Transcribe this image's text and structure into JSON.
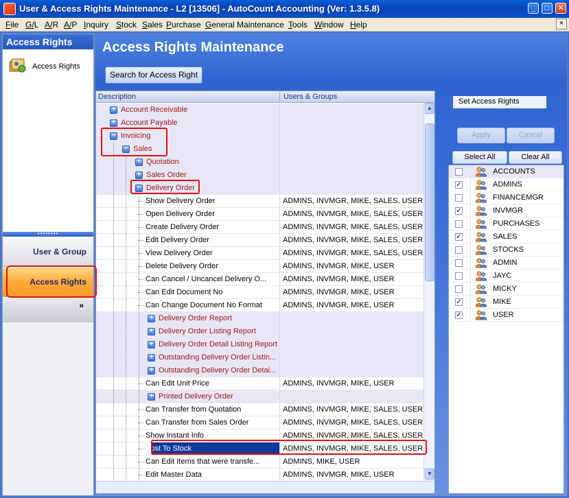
{
  "window": {
    "title": "User & Access Rights Maintenance - L2 [13506] - AutoCount Accounting (Ver: 1.3.5.8)",
    "minimize": "_",
    "maximize": "□",
    "close": "✕",
    "mdi_close": "×"
  },
  "menu": [
    "File",
    "G/L",
    "A/R",
    "A/P",
    "Inquiry",
    "Stock",
    "Sales",
    "Purchase",
    "General Maintenance",
    "Tools",
    "Window",
    "Help"
  ],
  "nav": {
    "header": "Access Rights",
    "item_label": "Access Rights",
    "splitter": "••••••••",
    "user_group": "User & Group",
    "access_rights": "Access Rights",
    "more": "»"
  },
  "main": {
    "title": "Access Rights Maintenance",
    "search_button": "Search for Access Right",
    "columns": {
      "description": "Description",
      "users": "Users & Groups"
    },
    "rows": [
      {
        "desc": "Account Receivable",
        "users": "",
        "level": 0,
        "cat": true,
        "exp": "+"
      },
      {
        "desc": "Account Payable",
        "users": "",
        "level": 0,
        "cat": true,
        "exp": "+"
      },
      {
        "desc": "Invoicing",
        "users": "",
        "level": 0,
        "cat": true,
        "exp": "−"
      },
      {
        "desc": "Sales",
        "users": "",
        "level": 1,
        "cat": true,
        "exp": "−"
      },
      {
        "desc": "Quotation",
        "users": "",
        "level": 2,
        "cat": true,
        "exp": "+"
      },
      {
        "desc": "Sales Order",
        "users": "",
        "level": 2,
        "cat": true,
        "exp": "+"
      },
      {
        "desc": "Delivery Order",
        "users": "",
        "level": 2,
        "cat": true,
        "exp": "−"
      },
      {
        "desc": "Show Delivery Order",
        "users": "ADMINS, INVMGR, MIKE, SALES, USER",
        "level": 3
      },
      {
        "desc": "Open Delivery Order",
        "users": "ADMINS, INVMGR, MIKE, SALES, USER",
        "level": 3
      },
      {
        "desc": "Create Delivery Order",
        "users": "ADMINS, INVMGR, MIKE, SALES, USER",
        "level": 3
      },
      {
        "desc": "Edit Delivery Order",
        "users": "ADMINS, INVMGR, MIKE, SALES, USER",
        "level": 3
      },
      {
        "desc": "View Delivery Order",
        "users": "ADMINS, INVMGR, MIKE, SALES, USER",
        "level": 3
      },
      {
        "desc": "Delete Delivery Order",
        "users": "ADMINS, INVMGR, MIKE, USER",
        "level": 3
      },
      {
        "desc": "Can Cancel / Uncancel Delivery O...",
        "users": "ADMINS, INVMGR, MIKE, USER",
        "level": 3
      },
      {
        "desc": "Can Edit Document No",
        "users": "ADMINS, INVMGR, MIKE, USER",
        "level": 3
      },
      {
        "desc": "Can Change Document No Format",
        "users": "ADMINS, INVMGR, MIKE, USER",
        "level": 3
      },
      {
        "desc": "Delivery Order Report",
        "users": "",
        "level": 3,
        "cat": true,
        "exp": "+"
      },
      {
        "desc": "Delivery Order Listing Report",
        "users": "",
        "level": 3,
        "cat": true,
        "exp": "+"
      },
      {
        "desc": "Delivery Order Detail Listing Report",
        "users": "",
        "level": 3,
        "cat": true,
        "exp": "+"
      },
      {
        "desc": "Outstanding Delivery Order Listin...",
        "users": "",
        "level": 3,
        "cat": true,
        "exp": "+"
      },
      {
        "desc": "Outstanding Delivery Order Detai...",
        "users": "",
        "level": 3,
        "cat": true,
        "exp": "+"
      },
      {
        "desc": "Can Edit Unit Price",
        "users": "ADMINS, INVMGR, MIKE, USER",
        "level": 3
      },
      {
        "desc": "Printed Delivery Order",
        "users": "",
        "level": 3,
        "cat": true,
        "exp": "+"
      },
      {
        "desc": "Can Transfer from Quotation",
        "users": "ADMINS, INVMGR, MIKE, SALES, USER",
        "level": 3
      },
      {
        "desc": "Can Transfer from Sales Order",
        "users": "ADMINS, INVMGR, MIKE, SALES, USER",
        "level": 3
      },
      {
        "desc": "Show Instant Info",
        "users": "ADMINS, INVMGR, MIKE, SALES, USER",
        "level": 3
      },
      {
        "desc": "Post To Stock",
        "users": "ADMINS, INVMGR, MIKE, SALES, USER",
        "level": 3,
        "selected": true
      },
      {
        "desc": "Can Edit Items that were transfe...",
        "users": "ADMINS, MIKE, USER",
        "level": 3
      },
      {
        "desc": "Edit Master Data",
        "users": "ADMINS, INVMGR, MIKE, USER",
        "level": 3
      }
    ],
    "scroll_up": "▲",
    "scroll_down": "▼"
  },
  "right": {
    "set_access_rights": "Set Access Rights",
    "apply": "Apply",
    "cancel": "Cancel",
    "select_all": "Select All",
    "clear_all": "Clear All",
    "users": [
      {
        "name": "ACCOUNTS",
        "checked": false,
        "group": true
      },
      {
        "name": "ADMINS",
        "checked": true
      },
      {
        "name": "FINANCEMGR",
        "checked": false
      },
      {
        "name": "INVMGR",
        "checked": true
      },
      {
        "name": "PURCHASES",
        "checked": false
      },
      {
        "name": "SALES",
        "checked": true
      },
      {
        "name": "STOCKS",
        "checked": false
      },
      {
        "name": "ADMIN",
        "checked": false
      },
      {
        "name": "JAYC",
        "checked": false
      },
      {
        "name": "MICKY",
        "checked": false
      },
      {
        "name": "MIKE",
        "checked": true
      },
      {
        "name": "USER",
        "checked": true
      }
    ]
  },
  "colors": {
    "accent": "#3064cf",
    "highlight": "#e01010",
    "category_text": "#9b1616",
    "selected_row": "#103a9a"
  }
}
